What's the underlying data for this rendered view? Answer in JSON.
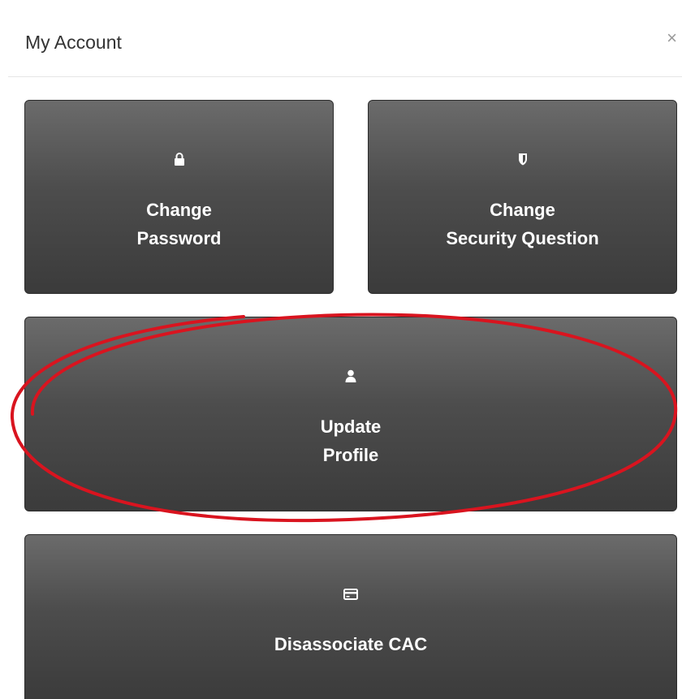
{
  "modal": {
    "title": "My Account",
    "close_label": "×"
  },
  "tiles": [
    {
      "label": "Change\nPassword",
      "icon": "lock-icon"
    },
    {
      "label": "Change\nSecurity Question",
      "icon": "shield-icon"
    },
    {
      "label": "Update\nProfile",
      "icon": "user-icon"
    },
    {
      "label": "Disassociate CAC",
      "icon": "card-icon"
    }
  ],
  "colors": {
    "tile_top": "#6b6b6b",
    "tile_bottom": "#3b3b3b",
    "highlight_ellipse": "#d9141f"
  }
}
